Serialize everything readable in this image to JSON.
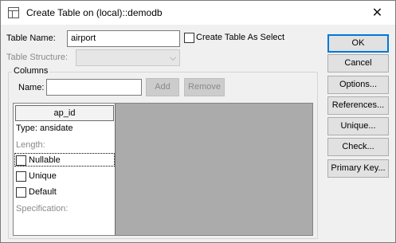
{
  "window": {
    "title": "Create Table on (local)::demodb",
    "close_glyph": "✕"
  },
  "form": {
    "table_name_label": "Table Name:",
    "table_name_value": "airport",
    "create_as_select_label": "Create Table As Select",
    "create_as_select_checked": false,
    "table_structure_label": "Table Structure:",
    "table_structure_value": ""
  },
  "columns": {
    "group_label": "Columns",
    "name_label": "Name:",
    "name_value": "",
    "add_label": "Add",
    "remove_label": "Remove",
    "grid": {
      "column_header": "ap_id",
      "type_text": "Type: ansidate",
      "length_label": "Length:",
      "nullable_label": "Nullable",
      "nullable_checked": false,
      "unique_label": "Unique",
      "unique_checked": false,
      "default_label": "Default",
      "default_checked": false,
      "specification_label": "Specification:"
    }
  },
  "buttons": {
    "ok": "OK",
    "cancel": "Cancel",
    "options": "Options...",
    "references": "References...",
    "unique": "Unique...",
    "check": "Check...",
    "primary_key": "Primary Key..."
  },
  "colors": {
    "dialog_bg": "#f0f0f0",
    "default_button_border": "#0078d7",
    "grid_empty_area": "#ababab"
  }
}
